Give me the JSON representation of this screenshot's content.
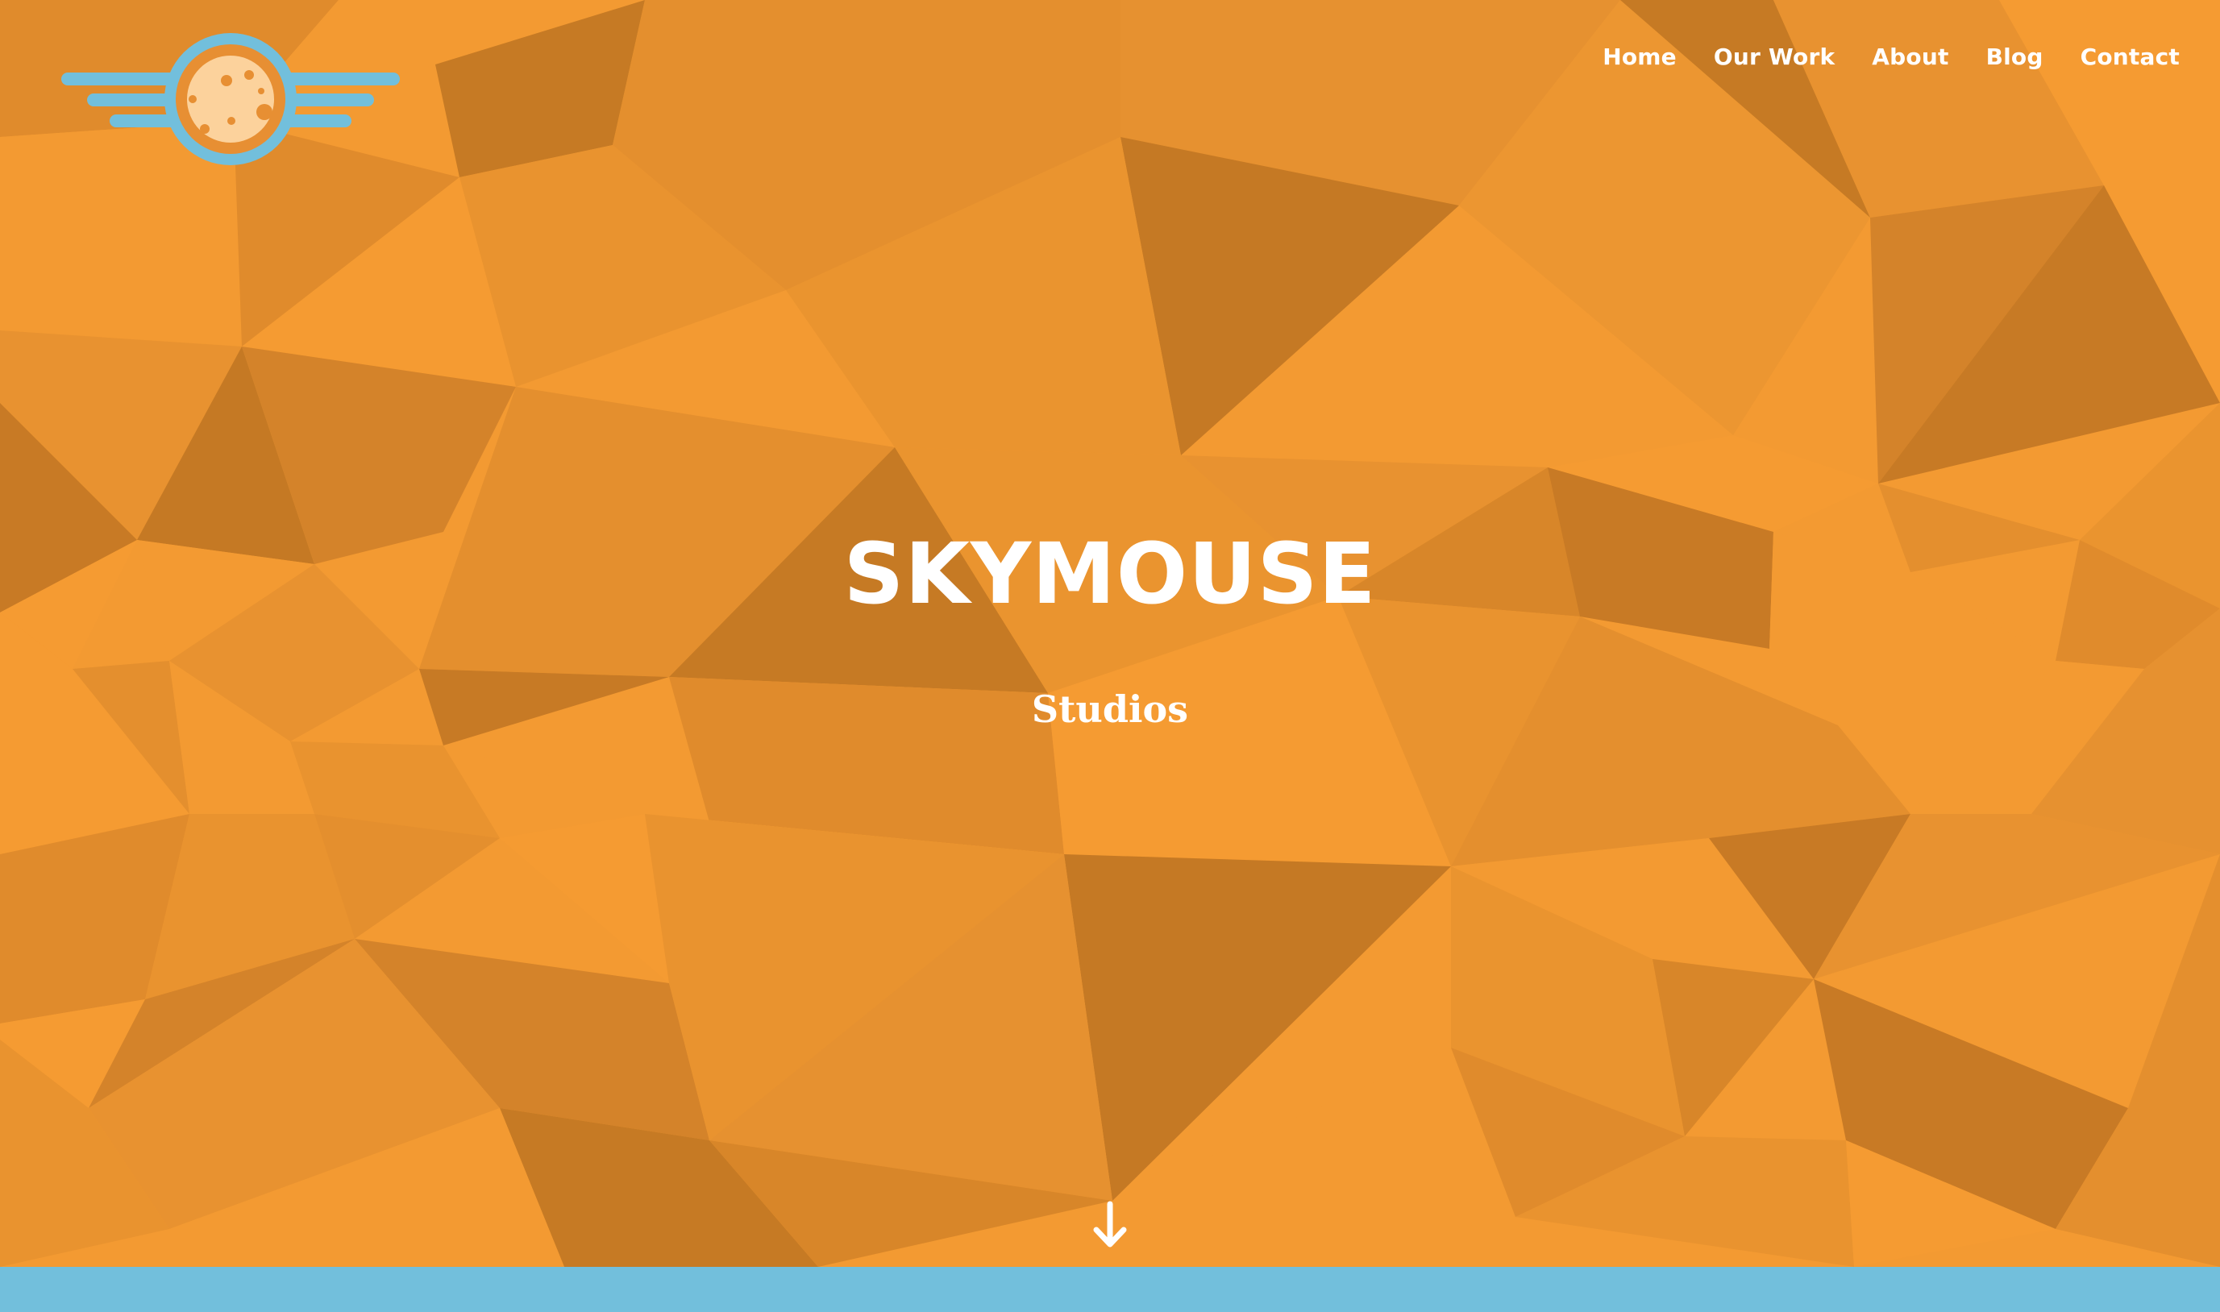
{
  "nav": {
    "items": [
      {
        "label": "Home"
      },
      {
        "label": "Our Work"
      },
      {
        "label": "About"
      },
      {
        "label": "Blog"
      },
      {
        "label": "Contact"
      }
    ]
  },
  "hero": {
    "title": "SKYMOUSE",
    "subtitle": "Studios"
  },
  "icons": {
    "logo": "winged-moon-icon",
    "scroll": "arrow-down-icon"
  },
  "colors": {
    "background_orange": "#f39a32",
    "facet_light": "#f59a30",
    "facet_mid": "#e48f2e",
    "facet_dark": "#c87a25",
    "accent_blue": "#72bfdc",
    "moon": "#fcd29c",
    "text": "#ffffff"
  }
}
